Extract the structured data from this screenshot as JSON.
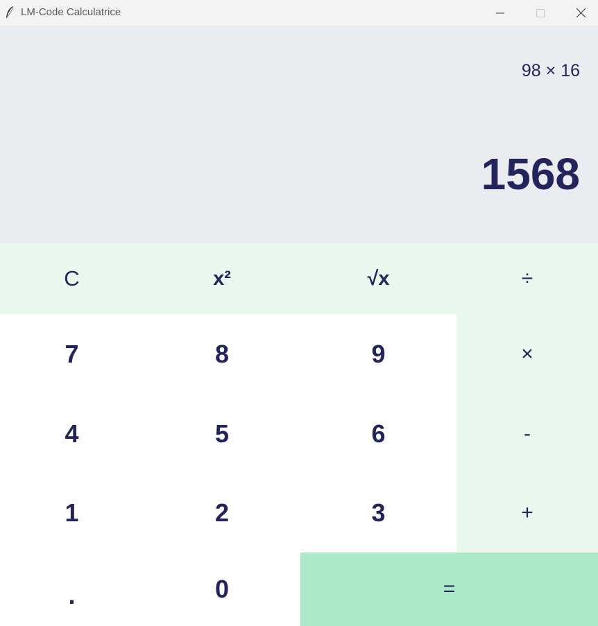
{
  "window": {
    "title": "LM-Code Calculatrice",
    "icon": "feather-icon",
    "controls": [
      "minimize-icon",
      "maximize-icon",
      "close-icon"
    ]
  },
  "display": {
    "expression": "98 × 16",
    "result": "1568"
  },
  "keys": {
    "clear": "C",
    "square": "x²",
    "sqrt": "√x",
    "divide": "÷",
    "multiply": "×",
    "subtract": "-",
    "add": "+",
    "equals": "=",
    "decimal": ".",
    "d0": "0",
    "d1": "1",
    "d2": "2",
    "d3": "3",
    "d4": "4",
    "d5": "5",
    "d6": "6",
    "d7": "7",
    "d8": "8",
    "d9": "9"
  },
  "colors": {
    "text": "#24245c",
    "display_bg": "#ebecef",
    "operator_bg": "#e8f8ee",
    "equals_bg": "#abe9c7",
    "digit_bg": "#ffffff"
  }
}
